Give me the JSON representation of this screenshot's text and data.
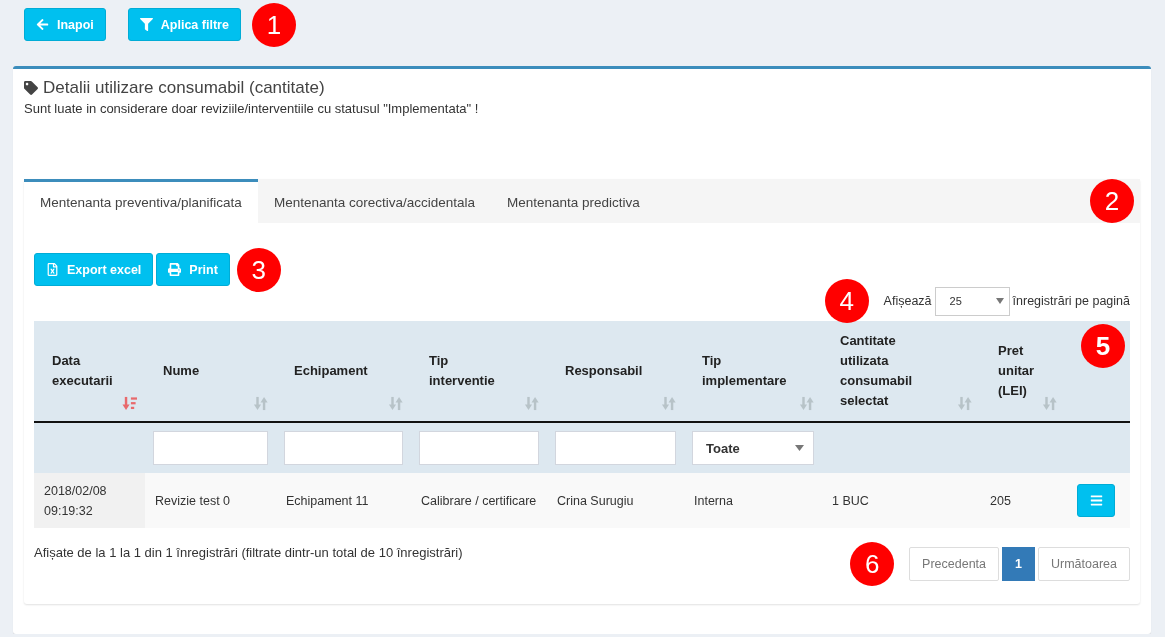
{
  "toolbar": {
    "buttons": [
      {
        "kind": "back",
        "label": "Inapoi"
      },
      {
        "kind": "filter",
        "label": "Aplica filtre"
      }
    ],
    "callout": "1"
  },
  "box": {
    "title": "Detalii utilizare consumabil (cantitate)",
    "note": "Sunt luate in considerare doar reviziile/interventiile cu statusul \"Implementata\" !"
  },
  "tabs": [
    {
      "label": "Mentenanta preventiva/planificata",
      "selected": true
    },
    {
      "label": "Mentenanta corectiva/accidentala",
      "selected": false
    },
    {
      "label": "Mentenanta predictiva",
      "selected": false
    }
  ],
  "tabs_callout": "2",
  "export_buttons": {
    "buttons": [
      {
        "kind": "excel",
        "label": "Export excel"
      },
      {
        "kind": "print",
        "label": "Print"
      }
    ],
    "callout": "3"
  },
  "page_length": {
    "callout": "4",
    "label_before": "Afișează",
    "value": "25",
    "label_after": "înregistrări pe pagină"
  },
  "table": {
    "callout": "5",
    "columns": [
      {
        "label": "Data executarii",
        "sorted": true
      },
      {
        "label": "Nume",
        "sorted": false,
        "filter": {
          "kind": "text"
        }
      },
      {
        "label": "Echipament",
        "sorted": false,
        "filter": {
          "kind": "text"
        }
      },
      {
        "label": "Tip interventie",
        "sorted": false,
        "filter": {
          "kind": "text"
        }
      },
      {
        "label": "Responsabil",
        "sorted": false,
        "filter": {
          "kind": "text"
        }
      },
      {
        "label": "Tip implementare",
        "sorted": false,
        "filter": {
          "kind": "select",
          "value": "Toate"
        }
      },
      {
        "label": "Cantitate utilizata consumabil selectat",
        "sorted": false
      },
      {
        "label": "Pret unitar (LEI)",
        "sorted": false
      }
    ],
    "rows": [
      {
        "cells": [
          "2018/02/08 09:19:32",
          "Revizie test 0",
          "Echipament 11",
          "Calibrare / certificare",
          "Crina Surugiu",
          "Interna",
          "1 BUC",
          "205"
        ]
      }
    ]
  },
  "info": "Afișate de la 1 la 1 din 1 înregistrări (filtrate dintr-un total de 10 înregistrări)",
  "pagination": {
    "callout": "6",
    "previous": {
      "label": "Precedenta",
      "disabled": true
    },
    "pages": [
      {
        "label": "1",
        "selected": true
      }
    ],
    "next": {
      "label": "Următoarea",
      "disabled": true
    }
  }
}
